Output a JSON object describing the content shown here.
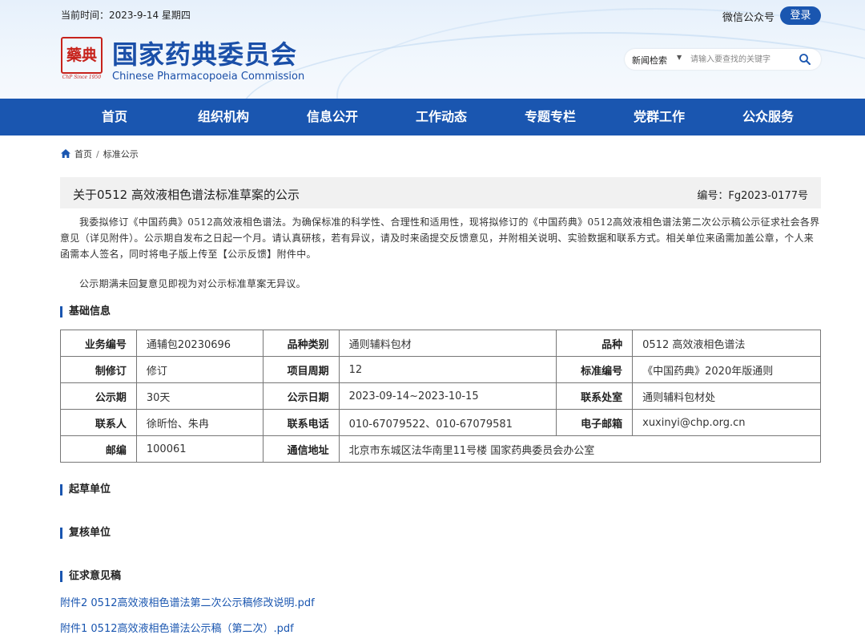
{
  "header": {
    "datetime": "当前时间：2023-9-14 星期四",
    "wechat": "微信公众号",
    "login": "登录",
    "logo_glyph": "藥典",
    "logo_since": "ChP Since 1950",
    "title": "国家药典委员会",
    "subtitle": "Chinese Pharmacopoeia Commission",
    "search": {
      "category": "新闻检索",
      "placeholder": "请输入要查找的关键字"
    }
  },
  "nav": {
    "items": [
      {
        "label": "首页"
      },
      {
        "label": "组织机构"
      },
      {
        "label": "信息公开"
      },
      {
        "label": "工作动态"
      },
      {
        "label": "专题专栏"
      },
      {
        "label": "党群工作"
      },
      {
        "label": "公众服务"
      }
    ]
  },
  "breadcrumb": {
    "home": "首页",
    "separator": "/",
    "current": "标准公示"
  },
  "article": {
    "title": "关于0512 高效液相色谱法标准草案的公示",
    "number": "编号：Fg2023-0177号",
    "paragraphs": [
      "我委拟修订《中国药典》0512高效液相色谱法。为确保标准的科学性、合理性和适用性，现将拟修订的《中国药典》0512高效液相色谱法第二次公示稿公示征求社会各界意见（详见附件）。公示期自发布之日起一个月。请认真研核，若有异议，请及时来函提交反馈意见，并附相关说明、实验数据和联系方式。相关单位来函需加盖公章，个人来函需本人签名，同时将电子版上传至【公示反馈】附件中。",
      "公示期满未回复意见即视为对公示标准草案无异议。"
    ]
  },
  "sections": {
    "basic": "基础信息",
    "drafting": "起草单位",
    "review": "复核单位",
    "consultation": "征求意见稿"
  },
  "table": {
    "rows": [
      [
        "业务编号",
        "通辅包20230696",
        "品种类别",
        "通则辅料包材",
        "品种",
        "0512 高效液相色谱法"
      ],
      [
        "制修订",
        "修订",
        "项目周期",
        "12",
        "标准编号",
        "《中国药典》2020年版通则"
      ],
      [
        "公示期",
        "30天",
        "公示日期",
        "2023-09-14~2023-10-15",
        "联系处室",
        "通则辅料包材处"
      ],
      [
        "联系人",
        "徐昕怡、朱冉",
        "联系电话",
        "010-67079522、010-67079581",
        "电子邮箱",
        "xuxinyi@chp.org.cn"
      ],
      [
        "邮编",
        "100061",
        "通信地址",
        "北京市东城区法华南里11号楼 国家药典委员会办公室"
      ]
    ]
  },
  "attachments": [
    "附件2 0512高效液相色谱法第二次公示稿修改说明.pdf",
    "附件1 0512高效液相色谱法公示稿（第二次）.pdf"
  ],
  "colors": {
    "brand_blue": "#1a56b0",
    "seal_red": "#c7231c"
  }
}
